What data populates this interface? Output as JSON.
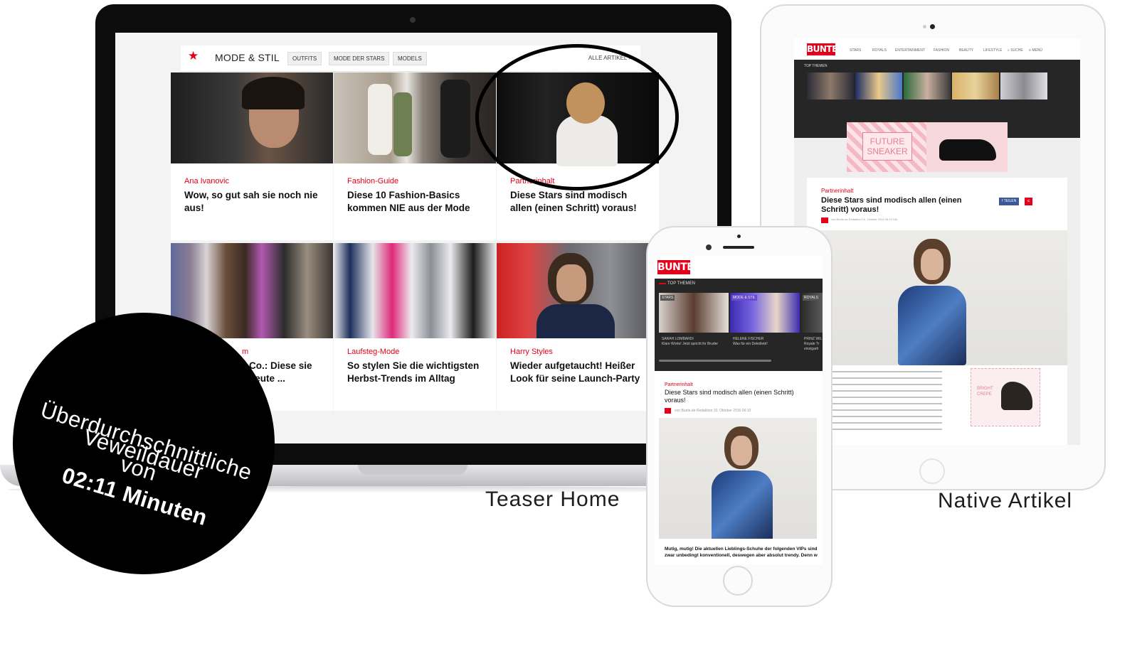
{
  "laptop": {
    "section": {
      "title": "MODE & STIL",
      "tabs": [
        "OUTFITS",
        "MODE DER STARS",
        "MODELS"
      ],
      "all_articles": "ALLE ARTIKEL"
    },
    "cards": [
      {
        "kicker": "Ana Ivanovic",
        "title": "Wow, so gut sah sie noch nie aus!"
      },
      {
        "kicker": "Fashion-Guide",
        "title": "Diese 10 Fashion-Basics kommen NIE aus der Mode"
      },
      {
        "kicker": "Partnerinhalt",
        "title": "Diese Stars sind modisch allen (einen Schritt) voraus!"
      },
      {
        "kicker": "m",
        "title": "Co.: Diese sie heute ..."
      },
      {
        "kicker": "Laufsteg-Mode",
        "title": "So stylen Sie die wichtigsten Herbst-Trends im Alltag"
      },
      {
        "kicker": "Harry Styles",
        "title": "Wieder aufgetaucht! Heißer Look für seine Launch-Party"
      }
    ]
  },
  "tablet": {
    "logo": "BUNTE",
    "nav": [
      "STARS",
      "ROYALS",
      "ENTERTAINMENT",
      "FASHION",
      "BEAUTY",
      "LIFESTYLE",
      "SUCHE",
      "MENÜ"
    ],
    "top_themen": "TOP THEMEN",
    "ad_text": "FUTURE SNEAKER",
    "article": {
      "kicker": "Partnerinhalt",
      "title": "Diese Stars sind modisch allen (einen Schritt) voraus!",
      "meta": "von Bunte.de Redaktion   10. Oktober 2016 06:10 Uhr",
      "share_label": "TEILEN",
      "ad2_text": "BRIGHT CREPE"
    }
  },
  "phone": {
    "logo": "BUNTE",
    "top_themen": "TOP THEMEN",
    "tiles": [
      {
        "tag": "STARS",
        "caption": "SARAH LOMBARDI\nKlare Worte! Jetzt spricht ihr Bruder"
      },
      {
        "tag": "MODE & STIL",
        "caption": "HELENE FISCHER\nWas für ein Dekolleté!"
      },
      {
        "tag": "ROYALS",
        "caption": "PRINZ WIL\nRoyale Tr einzigarti"
      }
    ],
    "article": {
      "kicker": "Partnerinhalt",
      "title": "Diese Stars sind modisch allen (einen Schritt) voraus!",
      "meta": "von Bunte.de Redaktion   10. Oktober 2016 06:10",
      "body": "Mutig, mutig! Die aktuellen Lieblings-Schuhe der folgenden VIPs sind zwar unbedingt konventionell, deswegen aber absolut trendy. Denn w"
    }
  },
  "captions": {
    "teaser": "Teaser Home",
    "native": "Native Artikel"
  },
  "badge": {
    "line1": "Überdurchschnittliche",
    "line2": "Veweildauer",
    "line3": "von",
    "line4": "02:11 Minuten"
  },
  "colors": {
    "brand_red": "#e3001b",
    "dark": "#262626"
  }
}
